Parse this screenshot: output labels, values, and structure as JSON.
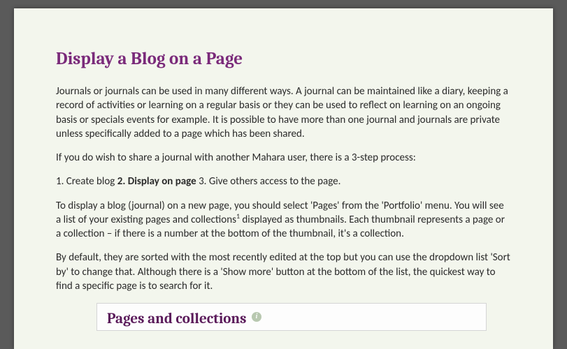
{
  "title": "Display a Blog on a Page",
  "para1": "Journals or journals can be used in many different ways.  A journal can be maintained like a diary, keeping a record of activities or learning on a regular basis or they can be used to reflect on learning on an ongoing basis or specials events for example.   It is possible to have more than one journal and journals are private unless specifically added to a page which has been shared.",
  "para2": "If you do wish to share a journal with another Mahara user, there is a 3-step process:",
  "steps_prefix": "1. Create blog ",
  "steps_bold": "2. Display on page",
  "steps_suffix": " 3. Give others access to the page.",
  "para4a": "To display a blog (journal) on a new page, you should select 'Pages' from the 'Portfolio' menu.   You will see a list of your existing pages and collections",
  "footnote_marker": "1",
  "para4b": " displayed as thumbnails.  Each thumbnail represents a page or a collection – if there is a number at the bottom of the thumbnail, it's a collection.",
  "para5": "By default, they are sorted with the most recently edited at the top but you can use the dropdown list 'Sort by' to change that.  Although there is a 'Show more' button at the bottom of the list, the quickest way to find a specific page is to search for it.",
  "panel_title": "Pages and collections",
  "info_glyph": "i"
}
